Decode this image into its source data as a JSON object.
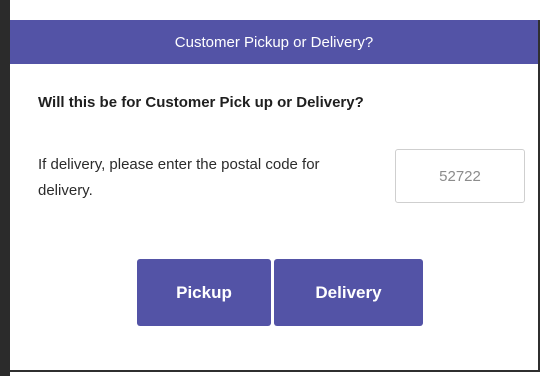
{
  "dialog": {
    "title": "Customer Pickup or Delivery?",
    "question": "Will this be for Customer Pick up or Delivery?",
    "postal_label": "If delivery, please enter the postal code for delivery.",
    "postal_input": {
      "value": "52722",
      "placeholder": ""
    },
    "buttons": {
      "pickup_label": "Pickup",
      "delivery_label": "Delivery"
    }
  },
  "colors": {
    "accent": "#5353a6",
    "text": "#1f1f1f",
    "input_text": "#8c8c8c"
  }
}
